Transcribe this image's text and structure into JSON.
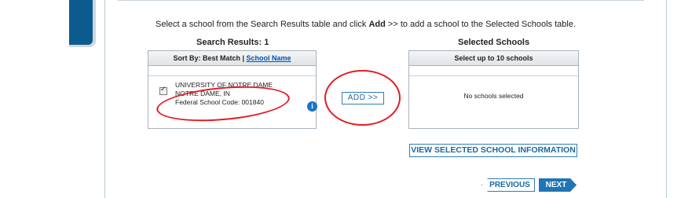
{
  "instruction": {
    "prefix": "Select a school from the Search Results table and click ",
    "bold": "Add",
    "suffix": " >> to add a school to the Selected Schools table."
  },
  "search_results": {
    "heading": "Search Results: 1",
    "sort_by_label": "Sort By:",
    "sort_best_match": "Best Match",
    "sort_separator": "|",
    "sort_school_name": "School Name",
    "result": {
      "name": "UNIVERSITY OF NOTRE DAME",
      "location": "NOTRE DAME, IN",
      "code": "Federal School Code: 001840"
    }
  },
  "add_button": "ADD >>",
  "selected_schools": {
    "heading": "Selected Schools",
    "subheading": "Select up to 10 schools",
    "empty_text": "No schools selected"
  },
  "view_button": "VIEW SELECTED SCHOOL INFORMATION",
  "previous_button": "PREVIOUS",
  "next_button": "NEXT",
  "colors": {
    "accent": "#1f75b5",
    "annotation": "#e21d23",
    "side_tab": "#0b5b8f"
  }
}
